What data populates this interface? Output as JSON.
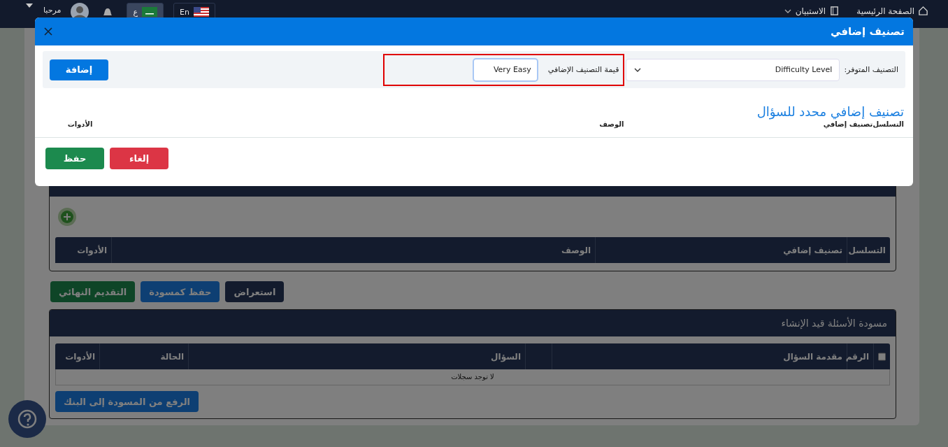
{
  "top_bar": {
    "nav": [
      {
        "label": "الصفحة الرئيسية",
        "kind": "home",
        "dropdown": false
      },
      {
        "label": "الاستبيان",
        "kind": "book",
        "dropdown": true
      }
    ],
    "languages": [
      {
        "label": "En",
        "kind": "us",
        "selected": false
      },
      {
        "label": "ع",
        "kind": "sa",
        "selected": true
      }
    ],
    "greeting": "مرحبا"
  },
  "page": {
    "classification_panel": {
      "columns": [
        "التسلسل",
        "تصنيف إضافي",
        "الوصف",
        "الأدوات"
      ]
    },
    "actions": [
      {
        "label": "استعراض",
        "kind": "dark"
      },
      {
        "label": "حفظ كمسودة",
        "kind": "primary"
      },
      {
        "label": "التقديم النهائي",
        "kind": "success"
      }
    ],
    "draft_panel": {
      "title": "مسودة الأسئلة قيد الإنشاء",
      "select_all_checked": false,
      "columns": [
        {
          "kind": "text",
          "label": "الرقم"
        },
        {
          "kind": "text",
          "label": "مقدمة السؤال"
        },
        {
          "kind": "blank"
        },
        {
          "kind": "text",
          "label": "السؤال"
        },
        {
          "kind": "text",
          "label": "الحالة"
        },
        {
          "kind": "text",
          "label": "الأدوات"
        }
      ],
      "empty_message": "لا توجد سجلات",
      "upload_button": "الرفع من المسودة إلى البنك"
    }
  },
  "modal": {
    "title": "تصنيف إضافي",
    "available_label": "التصنيف المتوفر:",
    "available_value": "Difficulty Level",
    "value_label": "قيمة التصنيف الإضافي",
    "value": "Very Easy",
    "value_highlighted": true,
    "add_button": "إضافة",
    "section_title": "تصنيف إضافي محدد للسؤال",
    "columns": [
      "التسلسل",
      "تصنيف إضافي",
      "الوصف",
      "الأدوات"
    ],
    "buttons": [
      {
        "label": "إلغاء",
        "kind": "danger"
      },
      {
        "label": "حفظ",
        "kind": "success"
      }
    ]
  }
}
